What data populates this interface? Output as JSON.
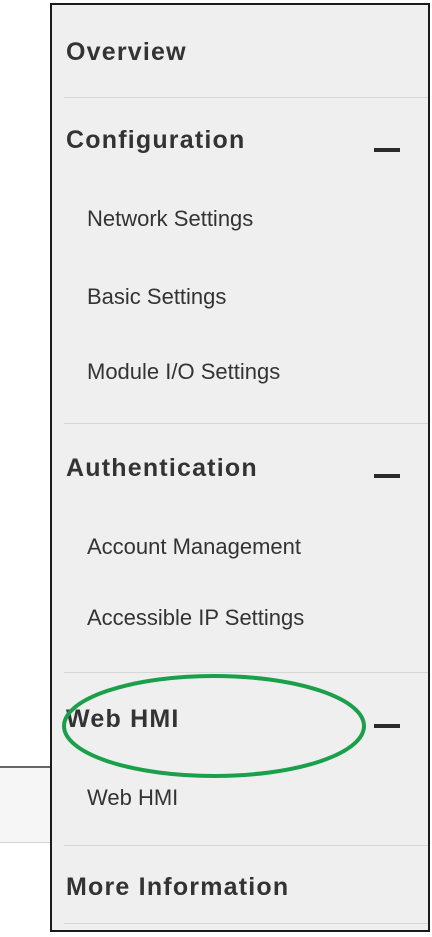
{
  "menu": {
    "overview": {
      "label": "Overview"
    },
    "configuration": {
      "label": "Configuration",
      "collapse_icon": "minus-icon",
      "items": [
        "Network Settings",
        "Basic Settings",
        "Module I/O Settings"
      ]
    },
    "authentication": {
      "label": "Authentication",
      "collapse_icon": "minus-icon",
      "items": [
        "Account Management",
        "Accessible IP Settings"
      ]
    },
    "web_hmi": {
      "label": "Web HMI",
      "collapse_icon": "minus-icon",
      "items": [
        "Web HMI"
      ]
    },
    "more_information": {
      "label": "More Information"
    }
  },
  "annotation": {
    "highlight_color": "#1a9f4a",
    "shape": "ellipse"
  },
  "colors": {
    "menu_background": "#efefef",
    "text": "#333333",
    "divider": "#d6d6d6"
  }
}
